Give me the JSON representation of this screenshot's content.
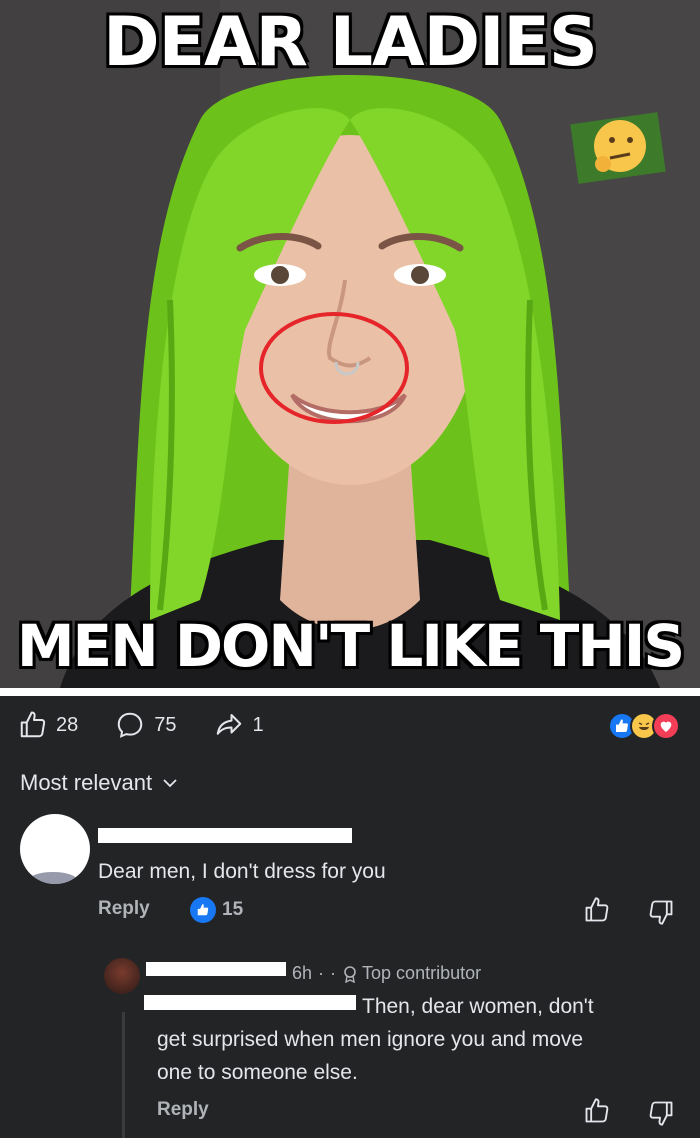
{
  "meme": {
    "top_text": "DEAR LADIES",
    "bottom_text": "MEN DON'T LIKE THIS",
    "thinking_emoji": "thinking-face-emoji"
  },
  "stats": {
    "likes": "28",
    "comments": "75",
    "shares": "1",
    "reactions": [
      "like-reaction",
      "haha-reaction",
      "love-reaction"
    ]
  },
  "sort": {
    "label": "Most relevant"
  },
  "comments": [
    {
      "text": "Dear men, I don't dress for you",
      "reply_label": "Reply",
      "like_count": "15"
    }
  ],
  "reply": {
    "time": "6h",
    "separator": "·",
    "badge": "Top contributor",
    "text_line1": "Then, dear women, don't",
    "text_line2": "get surprised when men ignore you and move",
    "text_line3": "one to someone else.",
    "reply_label": "Reply"
  },
  "colors": {
    "background": "#232426",
    "text": "#e4e6eb",
    "muted": "#b0b3b8",
    "hair": "#7ed321",
    "like_blue": "#1877f2",
    "love_red": "#f33e58",
    "circle_red": "#e5252a"
  }
}
